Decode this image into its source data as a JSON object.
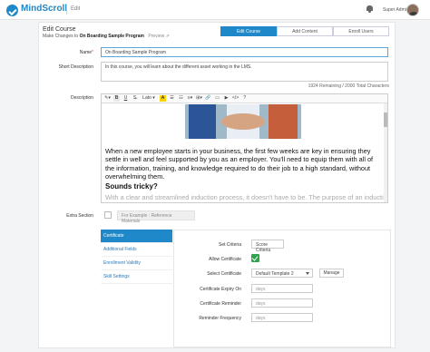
{
  "app": {
    "brand": "MindScroll",
    "breadcrumb": "Edit"
  },
  "user": {
    "name": "Super Admin",
    "menu_arrow": "▾"
  },
  "header": {
    "title": "Edit Course",
    "subtitle_prefix": "Make Changes to",
    "course_name": "On Boarding Sample Program",
    "preview_label": "Preview"
  },
  "tabs": [
    {
      "label": "Edit Course",
      "active": true
    },
    {
      "label": "Add Content",
      "active": false
    },
    {
      "label": "Enroll Users",
      "active": false
    }
  ],
  "form": {
    "name_label": "Name",
    "required_mark": "*",
    "name_value": "On Boarding Sample Program",
    "short_desc_label": "Short Description",
    "short_desc_value": "In this course, you will learn about the different asset working in the LMS.",
    "short_desc_counter": "1924 Remaining / 2000 Total Characters",
    "description_label": "Description",
    "extra_section_label": "Extra Section",
    "extra_section_placeholder": "For Example : Reference Materials"
  },
  "editor": {
    "toolbar": [
      "✎▾",
      "B",
      "U",
      "S̶",
      "Lato ▾",
      "A",
      "☰",
      "☷",
      "≡▾",
      "⊞▾",
      "🔗",
      "▭",
      "▶",
      "</>",
      "?"
    ],
    "paragraph": "When a new employee starts in your business, the first few weeks are key in ensuring they settle in well and feel supported by you as an employer. You'll need to equip them with all of the information, training, and knowledge required to do their job to a high standard, without overwhelming them.",
    "heading": "Sounds tricky?",
    "faded_text": "With a clear and streamlined induction process, it doesn't have to be. The purpose of an induction is to help"
  },
  "certificate": {
    "nav": [
      {
        "label": "Certificate",
        "active": true
      },
      {
        "label": "Additional Fields",
        "active": false
      },
      {
        "label": "Enrollment Validity",
        "active": false
      },
      {
        "label": "Skill Settings",
        "active": false
      }
    ],
    "set_criteria_label": "Set Criteria",
    "set_criteria_value": "Score Criteria",
    "allow_certificate_label": "Allow Certificate",
    "allow_certificate_checked": true,
    "select_certificate_label": "Select Certificate",
    "select_certificate_value": "Default Template 2",
    "manage_label": "Manage",
    "expiry_label": "Certificate Expiry On",
    "expiry_placeholder": "days",
    "reminder_label": "Certificate Reminder",
    "reminder_placeholder": "days",
    "frequency_label": "Reminder Frequency",
    "frequency_placeholder": "days"
  }
}
